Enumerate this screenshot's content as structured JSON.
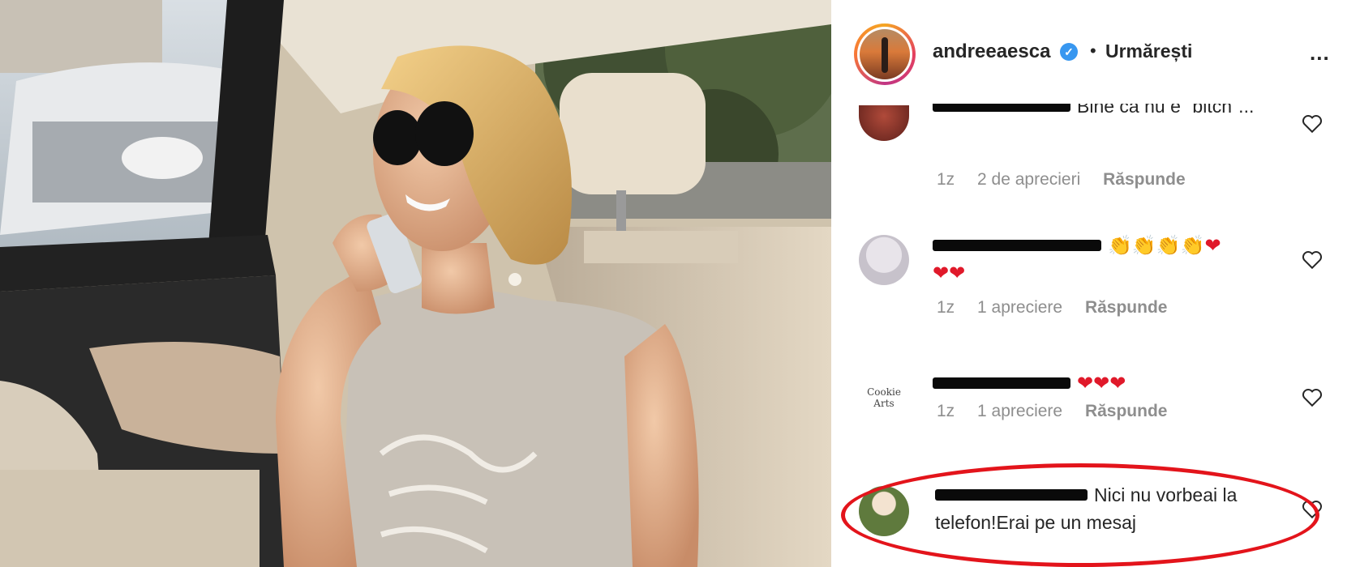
{
  "post": {
    "username": "andreeaesca",
    "separator": "•",
    "follow_status": "Urmărești",
    "more_glyph": "..."
  },
  "comments": [
    {
      "text": "Bine ca nu e \"bitch\"...",
      "time": "1z",
      "likes": "2 de aprecieri",
      "reply": "Răspunde"
    },
    {
      "emojis": [
        "clapping-hands",
        "clapping-hands",
        "clapping-hands",
        "clapping-hands",
        "red-heart",
        "red-heart",
        "red-heart"
      ],
      "time": "1z",
      "likes": "1 apreciere",
      "reply": "Răspunde"
    },
    {
      "avatar_text_1": "Cookie",
      "avatar_text_2": "Arts",
      "emojis": [
        "red-heart",
        "red-heart",
        "red-heart"
      ],
      "time": "1z",
      "likes": "1 apreciere",
      "reply": "Răspunde"
    },
    {
      "text": "Nici nu vorbeai la telefon!Erai pe un mesaj",
      "highlighted": true
    }
  ],
  "colors": {
    "highlight": "#e3141b",
    "verified": "#3897f0",
    "meta_text": "#8e8e8e",
    "body_text": "#262626"
  }
}
